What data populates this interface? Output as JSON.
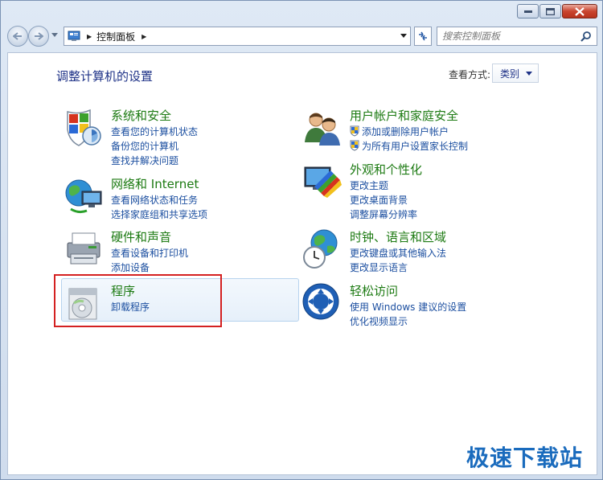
{
  "window": {
    "controls": {
      "minimize": "minimize",
      "maximize": "maximize",
      "close": "close"
    }
  },
  "address": {
    "crumb": "控制面板"
  },
  "search": {
    "placeholder": "搜索控制面板"
  },
  "header": {
    "title": "调整计算机的设置",
    "view_by_label": "查看方式:",
    "view_by_value": "类别"
  },
  "categories": [
    {
      "title": "系统和安全",
      "icon": "system-security-icon",
      "links": [
        "查看您的计算机状态",
        "备份您的计算机",
        "查找并解决问题"
      ]
    },
    {
      "title": "网络和 Internet",
      "icon": "network-internet-icon",
      "links": [
        "查看网络状态和任务",
        "选择家庭组和共享选项"
      ]
    },
    {
      "title": "硬件和声音",
      "icon": "hardware-sound-icon",
      "links": [
        "查看设备和打印机",
        "添加设备"
      ]
    },
    {
      "title": "程序",
      "icon": "programs-icon",
      "links": [
        "卸载程序"
      ]
    },
    {
      "title": "用户帐户和家庭安全",
      "icon": "user-accounts-icon",
      "links": [
        "添加或删除用户帐户",
        "为所有用户设置家长控制"
      ]
    },
    {
      "title": "外观和个性化",
      "icon": "appearance-icon",
      "links": [
        "更改主题",
        "更改桌面背景",
        "调整屏幕分辨率"
      ]
    },
    {
      "title": "时钟、语言和区域",
      "icon": "clock-language-icon",
      "links": [
        "更改键盘或其他输入法",
        "更改显示语言"
      ]
    },
    {
      "title": "轻松访问",
      "icon": "ease-of-access-icon",
      "links": [
        "使用 Windows 建议的设置",
        "优化视频显示"
      ]
    }
  ],
  "watermark": "极速下载站",
  "colors": {
    "title_blue": "#1e3287",
    "category_green": "#1c7a12",
    "link_blue": "#1c4fa0",
    "highlight_red": "#d42121"
  }
}
